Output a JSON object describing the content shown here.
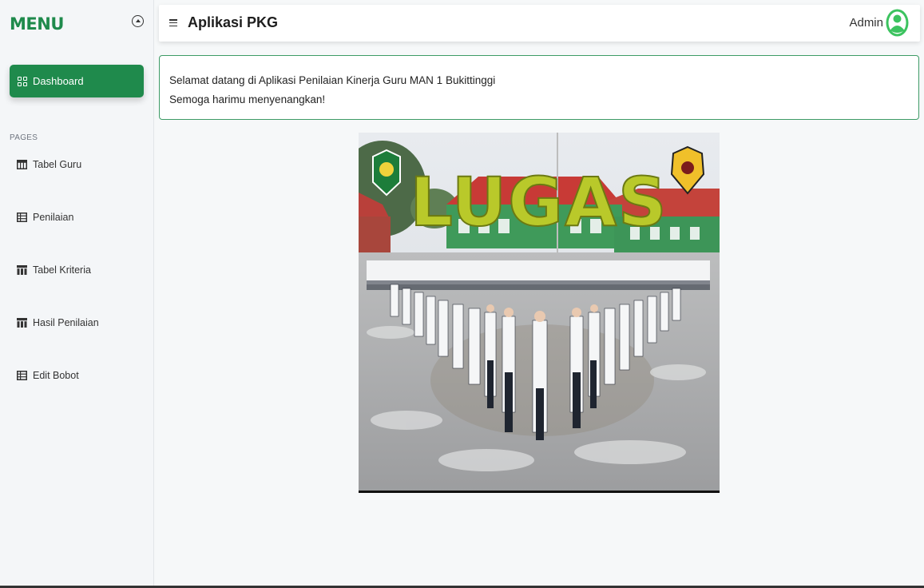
{
  "sidebar": {
    "title": "MENU",
    "collapse_icon": "circle-arrow-up-icon",
    "dashboard_label": "Dashboard",
    "section_label": "PAGES",
    "items": [
      {
        "label": "Tabel Guru",
        "icon": "table-icon"
      },
      {
        "label": "Penilaian",
        "icon": "table-icon"
      },
      {
        "label": "Tabel Kriteria",
        "icon": "table-columns-icon"
      },
      {
        "label": "Hasil Penilaian",
        "icon": "table-columns-icon"
      },
      {
        "label": "Edit Bobot",
        "icon": "table-icon"
      }
    ]
  },
  "header": {
    "title": "Aplikasi PKG",
    "user": "Admin",
    "menu_icon": "hamburger-icon",
    "avatar_icon": "user-avatar-icon"
  },
  "welcome": {
    "line1": "Selamat datang di Aplikasi Penilaian Kinerja Guru MAN 1 Bukittinggi",
    "line2": "Semoga harimu menyenangkan!"
  },
  "banner": {
    "text": "LUGAS"
  },
  "colors": {
    "accent": "#1f8a4c",
    "avatar": "#3cc35f",
    "border": "#3d9b66"
  }
}
